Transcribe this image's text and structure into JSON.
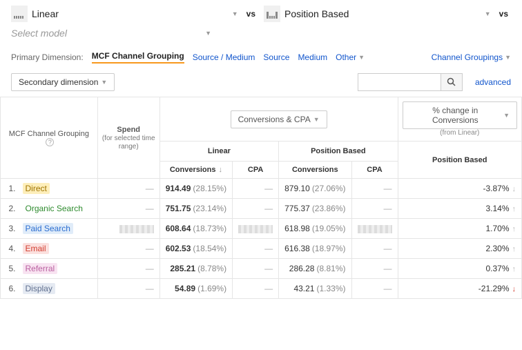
{
  "models": {
    "slot1": {
      "name": "Linear"
    },
    "slot2": {
      "name": "Position Based"
    },
    "placeholder": "Select model",
    "vs": "vs"
  },
  "pdim": {
    "label": "Primary Dimension:",
    "active": "MCF Channel Grouping",
    "links": [
      "Source / Medium",
      "Source",
      "Medium"
    ],
    "other": "Other",
    "groupings": "Channel Groupings"
  },
  "toolbar": {
    "secondary": "Secondary dimension",
    "advanced": "advanced",
    "search_placeholder": ""
  },
  "headers": {
    "channel": "MCF Channel Grouping",
    "spend": "Spend",
    "spend_note": "(for selected time range)",
    "metric_btn": "Conversions & CPA",
    "linear": "Linear",
    "position": "Position Based",
    "conversions": "Conversions",
    "cpa": "CPA",
    "change_btn": "% change in Conversions",
    "change_note": "(from Linear)",
    "change_col": "Position Based"
  },
  "rows": [
    {
      "idx": "1.",
      "name": "Direct",
      "cls": "c-direct",
      "spend": "—",
      "lin_c": "914.49",
      "lin_p": "(28.15%)",
      "lin_cpa": "—",
      "pos_c": "879.10",
      "pos_p": "(27.06%)",
      "pos_cpa": "—",
      "chg": "-3.87%",
      "dir": "down-grey"
    },
    {
      "idx": "2.",
      "name": "Organic Search",
      "cls": "c-organic",
      "spend": "—",
      "lin_c": "751.75",
      "lin_p": "(23.14%)",
      "lin_cpa": "—",
      "pos_c": "775.37",
      "pos_p": "(23.86%)",
      "pos_cpa": "—",
      "chg": "3.14%",
      "dir": "up-grey"
    },
    {
      "idx": "3.",
      "name": "Paid Search",
      "cls": "c-paid",
      "spend": "redacted",
      "lin_c": "608.64",
      "lin_p": "(18.73%)",
      "lin_cpa": "redacted",
      "pos_c": "618.98",
      "pos_p": "(19.05%)",
      "pos_cpa": "redacted",
      "chg": "1.70%",
      "dir": "up-grey"
    },
    {
      "idx": "4.",
      "name": "Email",
      "cls": "c-email",
      "spend": "—",
      "lin_c": "602.53",
      "lin_p": "(18.54%)",
      "lin_cpa": "—",
      "pos_c": "616.38",
      "pos_p": "(18.97%)",
      "pos_cpa": "—",
      "chg": "2.30%",
      "dir": "up-grey"
    },
    {
      "idx": "5.",
      "name": "Referral",
      "cls": "c-referral",
      "spend": "—",
      "lin_c": "285.21",
      "lin_p": "(8.78%)",
      "lin_cpa": "—",
      "pos_c": "286.28",
      "pos_p": "(8.81%)",
      "pos_cpa": "—",
      "chg": "0.37%",
      "dir": "up-grey"
    },
    {
      "idx": "6.",
      "name": "Display",
      "cls": "c-display",
      "spend": "—",
      "lin_c": "54.89",
      "lin_p": "(1.69%)",
      "lin_cpa": "—",
      "pos_c": "43.21",
      "pos_p": "(1.33%)",
      "pos_cpa": "—",
      "chg": "-21.29%",
      "dir": "down-red"
    }
  ]
}
